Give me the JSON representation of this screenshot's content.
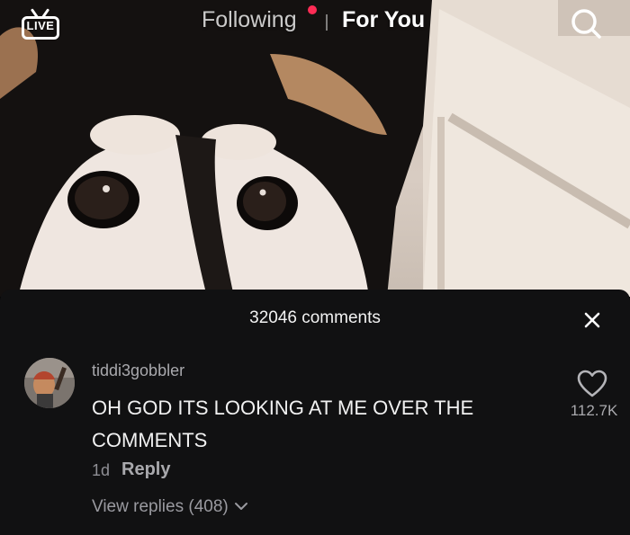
{
  "nav": {
    "live_label": "LIVE",
    "following_label": "Following",
    "foryou_label": "For You",
    "accent_color": "#fe2c55"
  },
  "comments_panel": {
    "title": "32046 comments",
    "close_icon": "close-icon"
  },
  "comment": {
    "username": "tiddi3gobbler",
    "text": "OH GOD ITS LOOKING AT ME OVER THE COMMENTS",
    "time": "1d",
    "reply_label": "Reply",
    "view_replies_label": "View replies (408)",
    "like_count": "112.7K",
    "like_icon": "heart-outline-icon"
  }
}
